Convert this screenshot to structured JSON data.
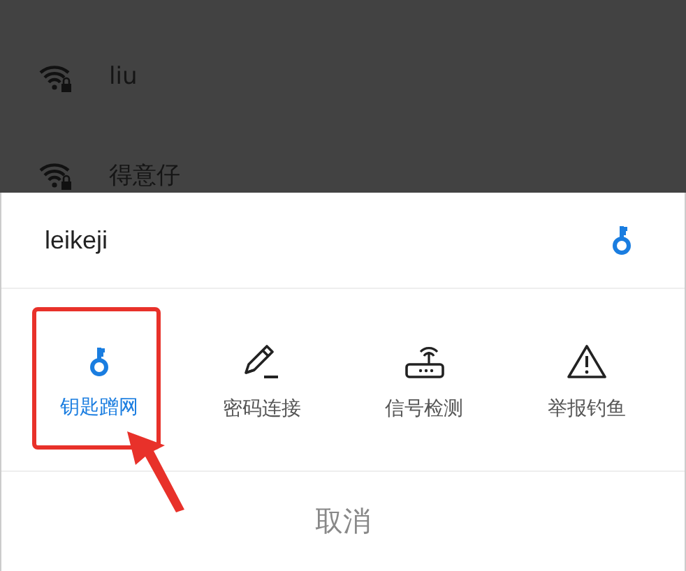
{
  "networks": [
    {
      "name": "liu",
      "locked": true
    },
    {
      "name": "得意仔",
      "locked": true
    }
  ],
  "sheet": {
    "title": "leikeji",
    "actions": [
      {
        "kind": "key",
        "label": "钥匙蹭网",
        "selected": true,
        "annotated": true
      },
      {
        "kind": "pencil",
        "label": "密码连接",
        "selected": false,
        "annotated": false
      },
      {
        "kind": "router",
        "label": "信号检测",
        "selected": false,
        "annotated": false
      },
      {
        "kind": "warning",
        "label": "举报钓鱼",
        "selected": false,
        "annotated": false
      }
    ],
    "cancel": "取消"
  }
}
